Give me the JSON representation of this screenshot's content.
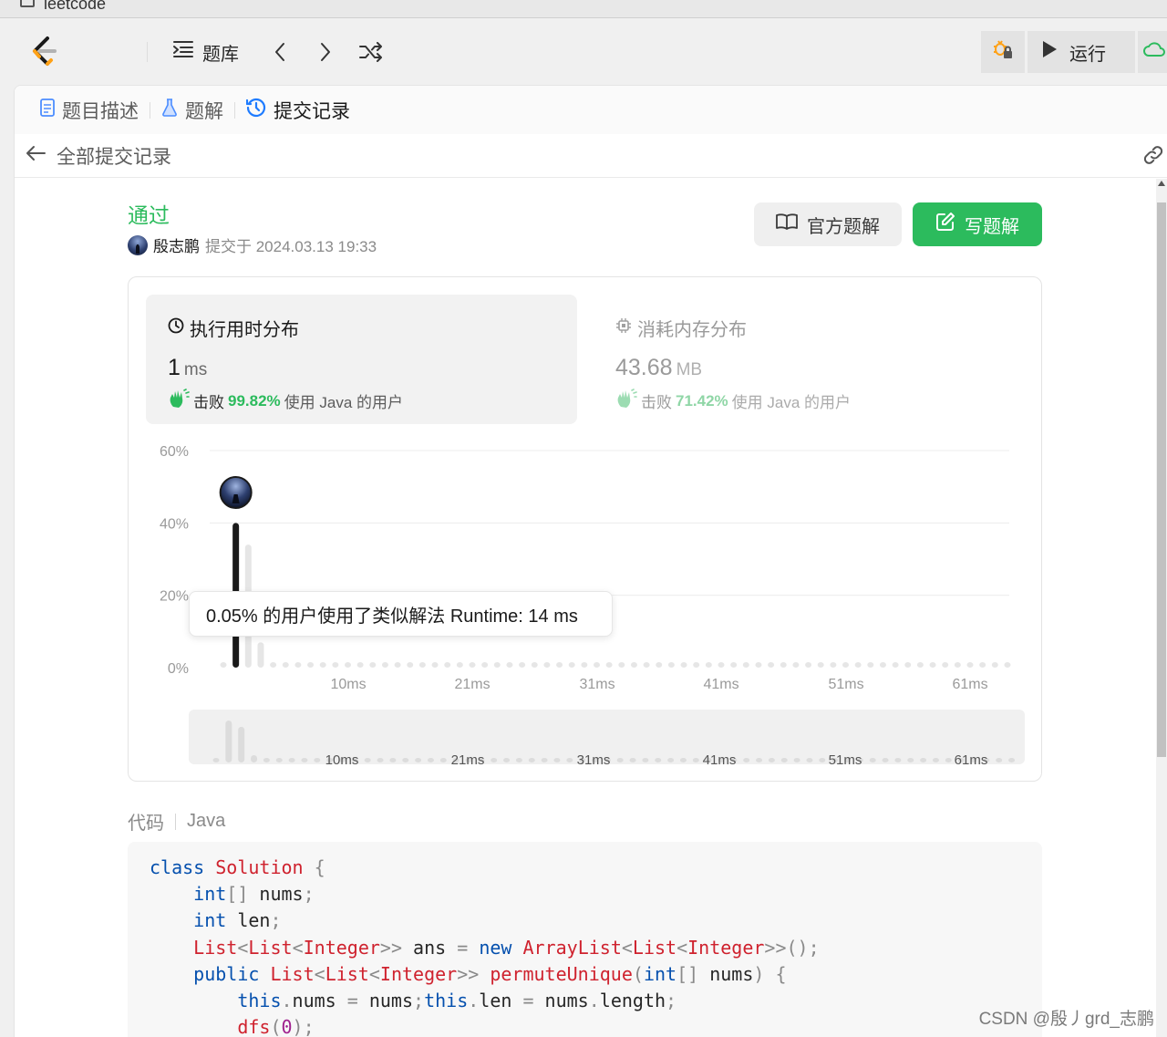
{
  "browser": {
    "tab_title": "leetcode"
  },
  "nav": {
    "problem_bank": "题库",
    "run": "运行"
  },
  "tabs": [
    {
      "label": "题目描述",
      "icon": "document-icon"
    },
    {
      "label": "题解",
      "icon": "flask-icon"
    },
    {
      "label": "提交记录",
      "icon": "history-icon",
      "active": true
    }
  ],
  "subheader": {
    "back_label": "全部提交记录"
  },
  "result": {
    "status": "通过",
    "status_color": "#2cbb5d",
    "user": "殷志鹏",
    "submitted_at": "提交于 2024.03.13 19:33",
    "official_solution_label": "官方题解",
    "write_solution_label": "写题解",
    "accent": "#2cbb5d"
  },
  "runtime": {
    "title": "执行用时分布",
    "value": "1",
    "unit": "ms",
    "beat_prefix": "击败",
    "beat_pct": "99.82%",
    "beat_suffix": "使用 Java 的用户"
  },
  "memory": {
    "title": "消耗内存分布",
    "value": "43.68",
    "unit": "MB",
    "beat_prefix": "击败",
    "beat_pct": "71.42%",
    "beat_suffix": "使用 Java 的用户"
  },
  "tooltip": "0.05% 的用户使用了类似解法 Runtime: 14 ms",
  "chart_data": {
    "type": "bar",
    "title": "",
    "xlabel": "",
    "ylabel": "",
    "ylim": [
      0,
      60
    ],
    "y_ticks": [
      "60%",
      "40%",
      "20%",
      "0%"
    ],
    "x_ticks": [
      "10ms",
      "21ms",
      "31ms",
      "41ms",
      "51ms",
      "61ms"
    ],
    "series": [
      {
        "values": [
          0.5,
          40,
          34,
          7,
          0.5,
          0.5,
          0.5,
          0.5,
          0.5,
          0.5,
          0.5,
          0.5,
          0.5,
          0.5,
          0.5,
          0.5,
          0.5,
          0.5,
          0.5,
          0.5,
          0.5,
          0.5,
          0.5,
          0.5,
          0.5,
          0.5,
          0.5,
          0.5,
          0.5,
          0.5,
          0.5,
          0.5,
          0.5,
          0.5,
          0.5,
          0.5,
          0.5,
          0.5,
          0.5,
          0.5,
          0.5,
          0.5,
          0.5,
          0.5,
          0.5,
          0.5,
          0.5,
          0.5,
          0.5,
          0.5,
          0.5,
          0.5,
          0.5,
          0.5,
          0.5,
          0.5,
          0.5,
          0.5,
          0.5,
          0.5,
          0.5,
          0.5,
          0.5,
          0.5
        ]
      }
    ],
    "highlight_index": 1,
    "grid": true
  },
  "code": {
    "label": "代码",
    "language": "Java"
  },
  "watermark": "CSDN @殷丿grd_志鹏"
}
